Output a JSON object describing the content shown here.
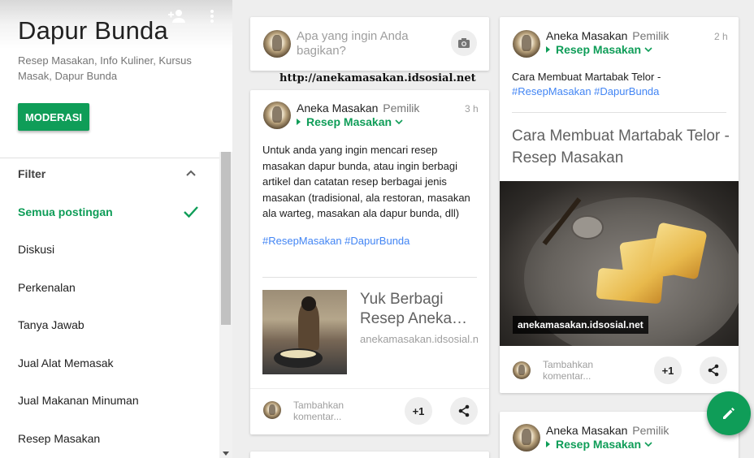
{
  "community": {
    "title": "Dapur Bunda",
    "description": "Resep Masakan, Info Kuliner, Kursus Masak, Dapur Bunda",
    "moderate_label": "MODERASI",
    "add_member_icon": "person-add-icon",
    "more_icon": "more-vert-icon"
  },
  "filter": {
    "heading": "Filter",
    "items": [
      {
        "label": "Semua postingan",
        "active": true
      },
      {
        "label": "Diskusi"
      },
      {
        "label": "Perkenalan"
      },
      {
        "label": "Tanya Jawab"
      },
      {
        "label": "Jual Alat Memasak"
      },
      {
        "label": "Jual Makanan Minuman"
      },
      {
        "label": "Resep Masakan"
      }
    ]
  },
  "composer": {
    "placeholder": "Apa yang ingin Anda bagikan?",
    "camera_icon": "camera-icon"
  },
  "overlay_url": "http://anekamasakan.idsosial.net",
  "posts": [
    {
      "author": "Aneka Masakan",
      "role": "Pemilik",
      "time": "3 h",
      "category": "Resep Masakan",
      "body": "Untuk anda yang ingin mencari resep masakan dapur bunda, atau ingin berbagi artikel dan catatan resep berbagai jenis masakan (tradisional, ala restoran, masakan ala warteg, masakan ala dapur bunda, dll)",
      "tags": "#ResepMasakan #DapurBunda",
      "link": {
        "title": "Yuk Berbagi Resep Aneka…",
        "url": "anekamasakan.idsosial.net"
      },
      "comment_placeholder": "Tambahkan komentar...",
      "plus_one": "+1"
    },
    {
      "author": "Aneka Masakan",
      "role": "Pemilik",
      "time": "2 h",
      "category": "Resep Masakan",
      "body": "Cara Membuat Martabak Telor -",
      "tags": "#ResepMasakan #DapurBunda",
      "title": "Cara Membuat Martabak Telor - Resep Masakan",
      "watermark": "anekamasakan.idsosial.net",
      "comment_placeholder": "Tambahkan komentar...",
      "plus_one": "+1"
    },
    {
      "author": "Aneka Masakan",
      "role": "Pemilik",
      "category": "Resep Masakan"
    }
  ],
  "fab_icon": "edit-pencil-icon",
  "colors": {
    "accent": "#0f9d58",
    "hashtag": "#4285f4",
    "background": "#eeeeee"
  }
}
